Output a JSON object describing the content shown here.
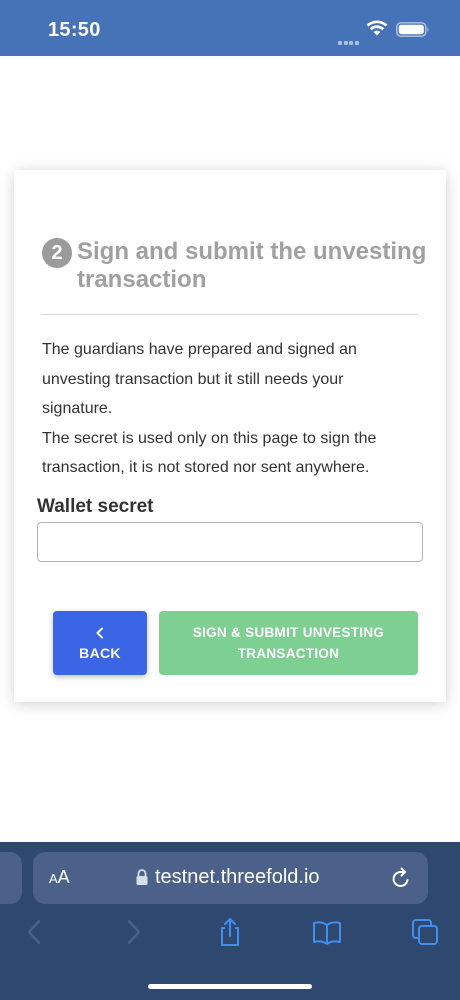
{
  "status_bar": {
    "time": "15:50",
    "background_color": "#4672b8"
  },
  "card": {
    "step_number": "2",
    "title": "Sign and submit the unvesting transaction",
    "description_lines": [
      "The guardians have prepared and signed an",
      "unvesting transaction but it still needs your",
      "signature.",
      "The secret is used only on this page to sign the",
      "transaction, it is not stored nor sent anywhere."
    ],
    "wallet_secret": {
      "label": "Wallet secret",
      "value": "",
      "placeholder": ""
    },
    "back_button": {
      "icon": "chevron-left-icon",
      "label": "BACK",
      "color": "#3a65e4"
    },
    "submit_button": {
      "line1": "SIGN & SUBMIT UNVESTING",
      "line2": "TRANSACTION",
      "color": "#7dcf92"
    }
  },
  "browser": {
    "text_size_label_small": "A",
    "text_size_label_large": "A",
    "url": "testnet.threefold.io",
    "toolbar_icons": [
      "back-arrow-icon",
      "forward-arrow-icon",
      "share-icon",
      "bookmarks-icon",
      "tabs-icon"
    ],
    "background_color": "#2f4870"
  }
}
